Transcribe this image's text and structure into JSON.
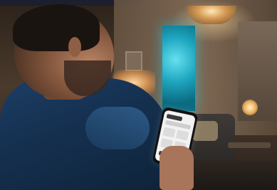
{
  "scene": {
    "colors": {
      "jacket": "#1c3e66",
      "painting_glow": "#1ea7c0",
      "lamp_light": "#ffe9b8",
      "phone_screen": "#f2f2f2"
    },
    "icons": [
      "phone-icon"
    ]
  }
}
